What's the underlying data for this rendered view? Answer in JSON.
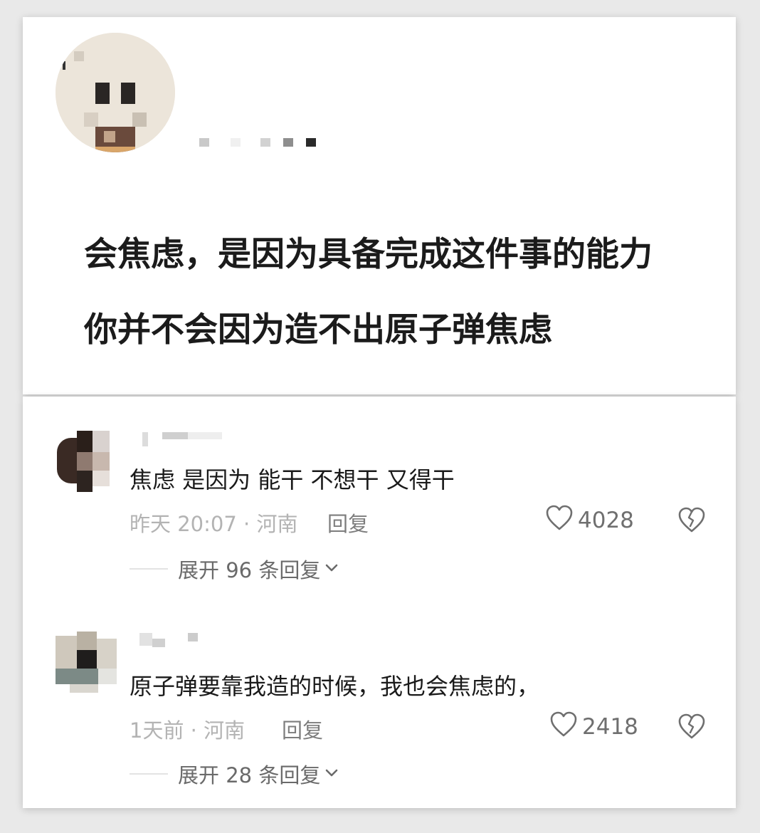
{
  "post": {
    "avatar_alt": "pixelated avatar",
    "line1": "会焦虑，是因为具备完成这件事的能力",
    "line2": "你并不会因为造不出原子弹焦虑"
  },
  "comments": [
    {
      "text": "焦虑 是因为 能干 不想干 又得干",
      "time_location": "昨天 20:07 · 河南",
      "reply_label": "回复",
      "likes": "4028",
      "expand_label": "展开 96 条回复"
    },
    {
      "text": "原子弹要靠我造的时候，我也会焦虑的，",
      "time_location": "1天前 · 河南",
      "reply_label": "回复",
      "likes": "2418",
      "expand_label": "展开 28 条回复"
    }
  ],
  "icons": {
    "like": "heart-outline-icon",
    "dislike": "broken-heart-icon",
    "expand": "chevron-down-icon"
  },
  "colors": {
    "background": "#e9e9e9",
    "card": "#ffffff",
    "post_text": "#1b1b1b",
    "meta_text": "#b3b3b3",
    "icon_gray": "#6f6f6f"
  }
}
